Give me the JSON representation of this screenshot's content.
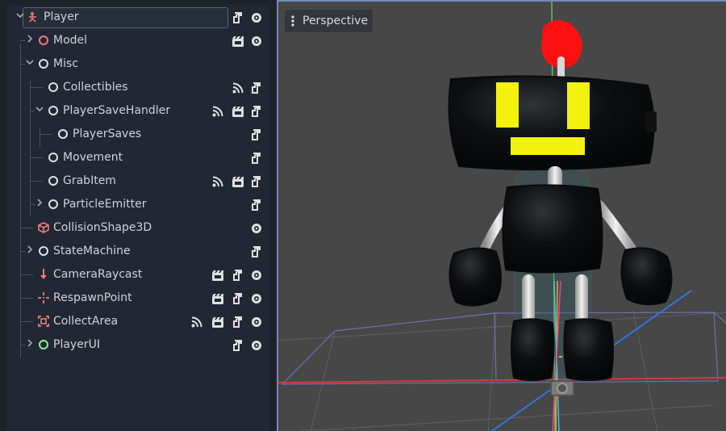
{
  "scene_tree": {
    "nodes": [
      {
        "name": "Player",
        "icon": "player-character-icon",
        "expand": "open",
        "color": "#e96d6d",
        "tags": [
          "script-icon",
          "visibility-eye-icon"
        ]
      },
      {
        "name": "Model",
        "icon": "node3d-red-ring-icon",
        "expand": "closed",
        "color": "#f07c7c",
        "tags": [
          "scene-instance-icon",
          "visibility-eye-icon"
        ]
      },
      {
        "name": "Misc",
        "icon": "node-ring-icon",
        "expand": "open",
        "color": "#e0e0e0",
        "tags": []
      },
      {
        "name": "Collectibles",
        "icon": "node-ring-icon",
        "expand": "none",
        "color": "#e0e0e0",
        "tags": [
          "signal-icon",
          "script-icon"
        ]
      },
      {
        "name": "PlayerSaveHandler",
        "icon": "node-ring-icon",
        "expand": "open",
        "color": "#e0e0e0",
        "tags": [
          "signal-icon",
          "scene-instance-icon",
          "script-icon"
        ]
      },
      {
        "name": "PlayerSaves",
        "icon": "node-ring-icon",
        "expand": "none",
        "color": "#e0e0e0",
        "tags": [
          "script-icon"
        ]
      },
      {
        "name": "Movement",
        "icon": "node-ring-icon",
        "expand": "none",
        "color": "#e0e0e0",
        "tags": [
          "script-icon"
        ]
      },
      {
        "name": "GrabItem",
        "icon": "node-ring-icon",
        "expand": "none",
        "color": "#e0e0e0",
        "tags": [
          "signal-icon",
          "scene-instance-icon",
          "script-icon"
        ]
      },
      {
        "name": "ParticleEmitter",
        "icon": "node-ring-icon",
        "expand": "closed",
        "color": "#e0e0e0",
        "tags": [
          "script-icon"
        ]
      },
      {
        "name": "CollisionShape3D",
        "icon": "collision-shape-cube-icon",
        "expand": "none",
        "color": "#f07c7c",
        "tags": [
          "visibility-eye-icon"
        ]
      },
      {
        "name": "StateMachine",
        "icon": "node-ring-icon",
        "expand": "closed",
        "color": "#e0e0e0",
        "tags": [
          "script-icon"
        ]
      },
      {
        "name": "CameraRaycast",
        "icon": "raycast-arrow-icon",
        "expand": "none",
        "color": "#f07c7c",
        "tags": [
          "scene-instance-icon",
          "script-icon",
          "visibility-eye-icon"
        ]
      },
      {
        "name": "RespawnPoint",
        "icon": "marker3d-crosshair-icon",
        "expand": "none",
        "color": "#f07c7c",
        "tags": [
          "scene-instance-icon",
          "script-icon",
          "visibility-eye-icon"
        ]
      },
      {
        "name": "CollectArea",
        "icon": "area3d-box-icon",
        "expand": "none",
        "color": "#f07c7c",
        "tags": [
          "signal-icon",
          "scene-instance-icon",
          "script-icon",
          "visibility-eye-icon"
        ]
      },
      {
        "name": "PlayerUI",
        "icon": "control-ring-icon",
        "expand": "closed",
        "color": "#8eef97",
        "tags": [
          "script-icon",
          "visibility-eye-icon"
        ]
      }
    ]
  },
  "viewport": {
    "menu_label": "Perspective",
    "menu_icon": "kebab-menu-icon"
  },
  "colors": {
    "panel_bg": "#212733",
    "viewport_bg": "#474747",
    "viewport_border": "#6d8bb8",
    "node3d_red": "#f07c7c",
    "control_green": "#8eef97",
    "robot_face_yellow": "#f2f20e",
    "antenna_red": "#ff1010"
  }
}
